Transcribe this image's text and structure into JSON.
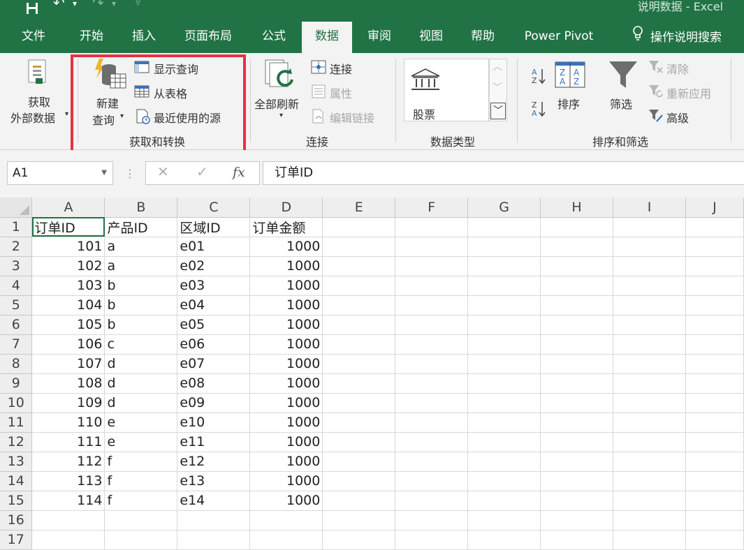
{
  "window": {
    "title": "说明数据  -  Excel",
    "quick_access": [
      "save-icon",
      "undo-icon",
      "redo-icon",
      "customize-icon"
    ]
  },
  "tabs": [
    {
      "label": "文件"
    },
    {
      "label": "开始"
    },
    {
      "label": "插入"
    },
    {
      "label": "页面布局"
    },
    {
      "label": "公式"
    },
    {
      "label": "数据",
      "active": true
    },
    {
      "label": "审阅"
    },
    {
      "label": "视图"
    },
    {
      "label": "帮助"
    },
    {
      "label": "Power Pivot"
    },
    {
      "label": "操作说明搜索",
      "icon": "lightbulb-icon"
    }
  ],
  "ribbon": {
    "get_external": {
      "line1": "获取",
      "line2": "外部数据"
    },
    "transform": {
      "new_query_line1": "新建",
      "new_query_line2": "查询",
      "show_queries": "显示查询",
      "from_table": "从表格",
      "recent_sources": "最近使用的源",
      "group_label": "获取和转换"
    },
    "connections": {
      "refresh_all": "全部刷新",
      "connections": "连接",
      "properties": "属性",
      "edit_links": "编辑链接",
      "group_label": "连接"
    },
    "data_types": {
      "stocks": "股票",
      "group_label": "数据类型"
    },
    "sort_filter": {
      "sort": "排序",
      "filter": "筛选",
      "clear": "清除",
      "reapply": "重新应用",
      "advanced": "高级",
      "group_label": "排序和筛选"
    }
  },
  "formula_bar": {
    "name_box": "A1",
    "fx": "fx",
    "content": "订单ID"
  },
  "sheet": {
    "columns": [
      "A",
      "B",
      "C",
      "D",
      "E",
      "F",
      "G",
      "H",
      "I",
      "J"
    ],
    "selected_cell": "A1",
    "rows": [
      {
        "n": "1",
        "cells": [
          "订单ID",
          "产品ID",
          "区域ID",
          "订单金额"
        ]
      },
      {
        "n": "2",
        "cells": [
          "101",
          "a",
          "e01",
          "1000"
        ]
      },
      {
        "n": "3",
        "cells": [
          "102",
          "a",
          "e02",
          "1000"
        ]
      },
      {
        "n": "4",
        "cells": [
          "103",
          "b",
          "e03",
          "1000"
        ]
      },
      {
        "n": "5",
        "cells": [
          "104",
          "b",
          "e04",
          "1000"
        ]
      },
      {
        "n": "6",
        "cells": [
          "105",
          "b",
          "e05",
          "1000"
        ]
      },
      {
        "n": "7",
        "cells": [
          "106",
          "c",
          "e06",
          "1000"
        ]
      },
      {
        "n": "8",
        "cells": [
          "107",
          "d",
          "e07",
          "1000"
        ]
      },
      {
        "n": "9",
        "cells": [
          "108",
          "d",
          "e08",
          "1000"
        ]
      },
      {
        "n": "10",
        "cells": [
          "109",
          "d",
          "e09",
          "1000"
        ]
      },
      {
        "n": "11",
        "cells": [
          "110",
          "e",
          "e10",
          "1000"
        ]
      },
      {
        "n": "12",
        "cells": [
          "111",
          "e",
          "e11",
          "1000"
        ]
      },
      {
        "n": "13",
        "cells": [
          "112",
          "f",
          "e12",
          "1000"
        ]
      },
      {
        "n": "14",
        "cells": [
          "113",
          "f",
          "e13",
          "1000"
        ]
      },
      {
        "n": "15",
        "cells": [
          "114",
          "f",
          "e14",
          "1000"
        ]
      },
      {
        "n": "16",
        "cells": [
          "",
          "",
          "",
          ""
        ]
      },
      {
        "n": "17",
        "cells": [
          "",
          "",
          "",
          ""
        ]
      }
    ]
  },
  "colors": {
    "excel_green": "#217346",
    "highlight_red": "#e8313f"
  }
}
